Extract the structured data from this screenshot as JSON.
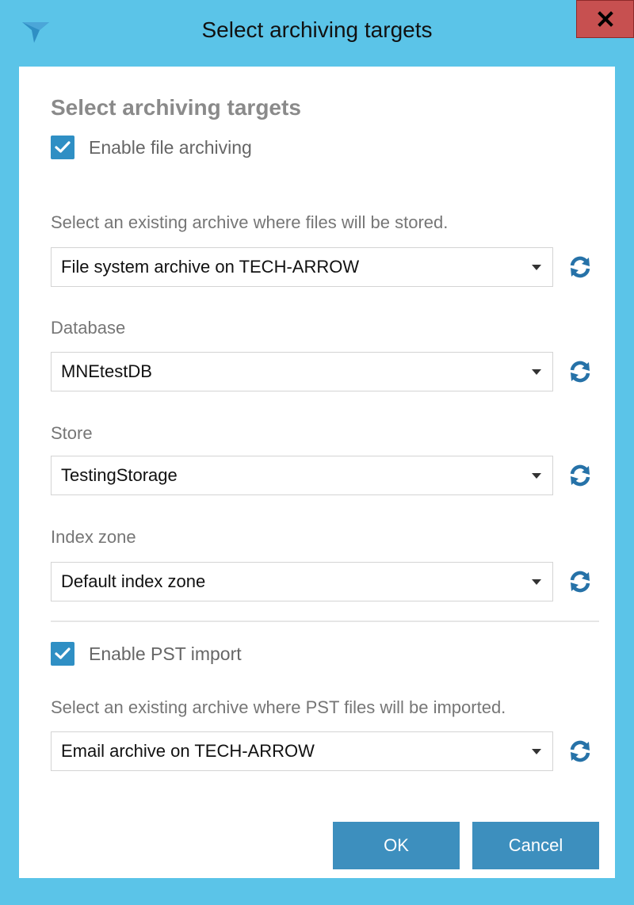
{
  "window": {
    "title": "Select archiving targets",
    "close_label": "x"
  },
  "heading": "Select archiving targets",
  "file_archiving": {
    "checkbox_label": "Enable file archiving",
    "checked": true,
    "description": "Select an existing archive where files will be stored.",
    "archive_value": "File system archive on TECH-ARROW",
    "database_label": "Database",
    "database_value": "MNEtestDB",
    "store_label": "Store",
    "store_value": "TestingStorage",
    "index_zone_label": "Index zone",
    "index_zone_value": "Default index zone"
  },
  "pst_import": {
    "checkbox_label": "Enable PST import",
    "checked": true,
    "description": "Select an existing archive where PST files will be imported.",
    "archive_value": "Email archive on TECH-ARROW"
  },
  "buttons": {
    "ok": "OK",
    "cancel": "Cancel"
  },
  "colors": {
    "titlebar": "#5bc4e8",
    "close_button": "#c75050",
    "accent": "#2f8fc4",
    "button": "#3d8fbe"
  },
  "icons": {
    "app": "app-logo-icon",
    "close": "close-icon",
    "check": "checkmark-icon",
    "dropdown": "chevron-down-icon",
    "refresh": "refresh-icon"
  }
}
